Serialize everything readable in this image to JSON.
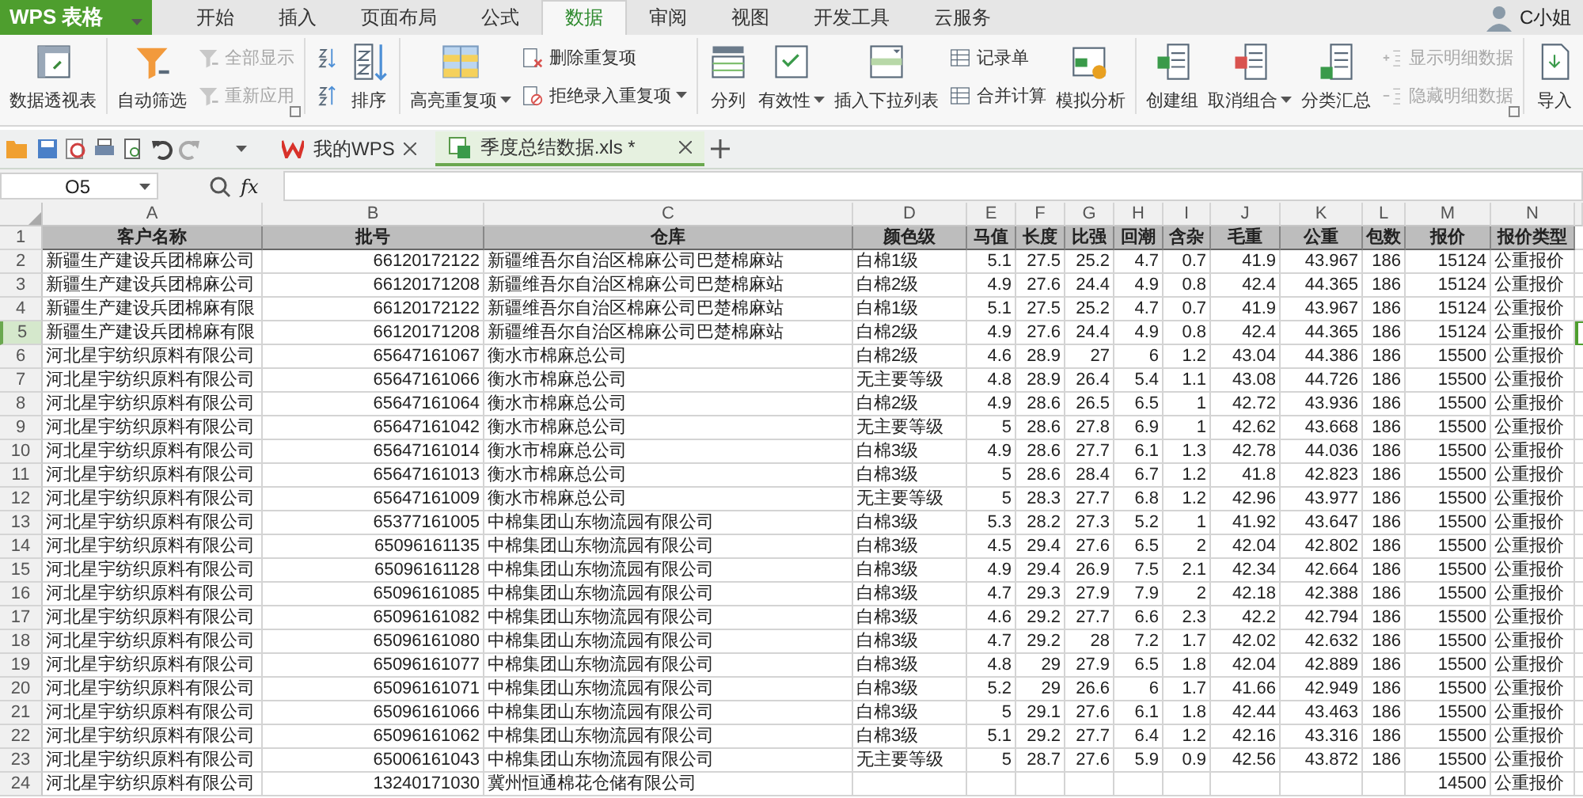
{
  "app": {
    "title": "WPS 表格"
  },
  "menu_tabs": [
    {
      "label": "开始",
      "selected": false
    },
    {
      "label": "插入",
      "selected": false
    },
    {
      "label": "页面布局",
      "selected": false
    },
    {
      "label": "公式",
      "selected": false
    },
    {
      "label": "数据",
      "selected": true
    },
    {
      "label": "审阅",
      "selected": false
    },
    {
      "label": "视图",
      "selected": false
    },
    {
      "label": "开发工具",
      "selected": false
    },
    {
      "label": "云服务",
      "selected": false
    }
  ],
  "user": {
    "name": "C小姐"
  },
  "ribbon": [
    {
      "columns": [
        [
          {
            "kind": "large",
            "label": "数据透视表",
            "disabled": false
          }
        ]
      ]
    },
    {
      "launcher": true,
      "columns": [
        [
          {
            "kind": "large",
            "label": "自动筛选",
            "disabled": false
          }
        ],
        [
          {
            "kind": "small",
            "label": "全部显示",
            "disabled": true
          },
          {
            "kind": "small",
            "label": "重新应用",
            "disabled": true
          }
        ]
      ]
    },
    {
      "columns": [
        [
          {
            "kind": "icon",
            "disabled": false
          },
          {
            "kind": "icon",
            "disabled": false
          }
        ],
        [
          {
            "kind": "large",
            "label": "排序",
            "disabled": false
          }
        ]
      ]
    },
    {
      "columns": [
        [
          {
            "kind": "large",
            "label": "高亮重复项",
            "disabled": false,
            "dropdown": true
          }
        ],
        [
          {
            "kind": "small",
            "label": "删除重复项",
            "disabled": false
          },
          {
            "kind": "small",
            "label": "拒绝录入重复项",
            "disabled": false,
            "dropdown": true
          }
        ]
      ]
    },
    {
      "columns": [
        [
          {
            "kind": "large",
            "label": "分列",
            "disabled": false
          }
        ],
        [
          {
            "kind": "large",
            "label": "有效性",
            "disabled": false,
            "dropdown": true
          }
        ],
        [
          {
            "kind": "large",
            "label": "插入下拉列表",
            "disabled": false
          }
        ],
        [
          {
            "kind": "small",
            "label": "记录单",
            "disabled": false
          },
          {
            "kind": "small",
            "label": "合并计算",
            "disabled": false
          }
        ],
        [
          {
            "kind": "large",
            "label": "模拟分析",
            "disabled": false
          }
        ]
      ]
    },
    {
      "launcher": true,
      "columns": [
        [
          {
            "kind": "large",
            "label": "创建组",
            "disabled": false
          }
        ],
        [
          {
            "kind": "large",
            "label": "取消组合",
            "disabled": false,
            "dropdown": true
          }
        ],
        [
          {
            "kind": "large",
            "label": "分类汇总",
            "disabled": false
          }
        ],
        [
          {
            "kind": "small",
            "label": "显示明细数据",
            "disabled": true
          },
          {
            "kind": "small",
            "label": "隐藏明细数据",
            "disabled": true
          }
        ]
      ]
    },
    {
      "columns": [
        [
          {
            "kind": "large",
            "label": "导入",
            "disabled": false
          }
        ]
      ]
    }
  ],
  "doc_tabs": [
    {
      "title": "我的WPS",
      "selected": false
    },
    {
      "title": "季度总结数据.xls *",
      "selected": true
    }
  ],
  "formula_bar": {
    "name_box": "O5",
    "fx": "fx"
  },
  "columns": [
    "A",
    "B",
    "C",
    "D",
    "E",
    "F",
    "G",
    "H",
    "I",
    "J",
    "K",
    "L",
    "M",
    "N"
  ],
  "header_row": {
    "number": "1",
    "cells": [
      "客户名称",
      "批号",
      "仓库",
      "颜色级",
      "马值",
      "长度",
      "比强",
      "回潮",
      "含杂",
      "毛重",
      "公重",
      "包数",
      "报价",
      "报价类型"
    ]
  },
  "rows": [
    {
      "number": "2",
      "selected": false,
      "cells": [
        "新疆生产建设兵团棉麻公司",
        "66120172122",
        "新疆维吾尔自治区棉麻公司巴楚棉麻站",
        "白棉1级",
        "5.1",
        "27.5",
        "25.2",
        "4.7",
        "0.7",
        "41.9",
        "43.967",
        "186",
        "15124",
        "公重报价"
      ]
    },
    {
      "number": "3",
      "selected": false,
      "cells": [
        "新疆生产建设兵团棉麻公司",
        "66120171208",
        "新疆维吾尔自治区棉麻公司巴楚棉麻站",
        "白棉2级",
        "4.9",
        "27.6",
        "24.4",
        "4.9",
        "0.8",
        "42.4",
        "44.365",
        "186",
        "15124",
        "公重报价"
      ]
    },
    {
      "number": "4",
      "selected": false,
      "cells": [
        "新疆生产建设兵团棉麻有限",
        "66120172122",
        "新疆维吾尔自治区棉麻公司巴楚棉麻站",
        "白棉1级",
        "5.1",
        "27.5",
        "25.2",
        "4.7",
        "0.7",
        "41.9",
        "43.967",
        "186",
        "15124",
        "公重报价"
      ]
    },
    {
      "number": "5",
      "selected": true,
      "cells": [
        "新疆生产建设兵团棉麻有限",
        "66120171208",
        "新疆维吾尔自治区棉麻公司巴楚棉麻站",
        "白棉2级",
        "4.9",
        "27.6",
        "24.4",
        "4.9",
        "0.8",
        "42.4",
        "44.365",
        "186",
        "15124",
        "公重报价"
      ]
    },
    {
      "number": "6",
      "selected": false,
      "cells": [
        "河北星宇纺织原料有限公司",
        "65647161067",
        "衡水市棉麻总公司",
        "白棉2级",
        "4.6",
        "28.9",
        "27",
        "6",
        "1.2",
        "43.04",
        "44.386",
        "186",
        "15500",
        "公重报价"
      ]
    },
    {
      "number": "7",
      "selected": false,
      "cells": [
        "河北星宇纺织原料有限公司",
        "65647161066",
        "衡水市棉麻总公司",
        "无主要等级",
        "4.8",
        "28.9",
        "26.4",
        "5.4",
        "1.1",
        "43.08",
        "44.726",
        "186",
        "15500",
        "公重报价"
      ]
    },
    {
      "number": "8",
      "selected": false,
      "cells": [
        "河北星宇纺织原料有限公司",
        "65647161064",
        "衡水市棉麻总公司",
        "白棉2级",
        "4.9",
        "28.6",
        "26.5",
        "6.5",
        "1",
        "42.72",
        "43.936",
        "186",
        "15500",
        "公重报价"
      ]
    },
    {
      "number": "9",
      "selected": false,
      "cells": [
        "河北星宇纺织原料有限公司",
        "65647161042",
        "衡水市棉麻总公司",
        "无主要等级",
        "5",
        "28.6",
        "27.8",
        "6.9",
        "1",
        "42.62",
        "43.668",
        "186",
        "15500",
        "公重报价"
      ]
    },
    {
      "number": "10",
      "selected": false,
      "cells": [
        "河北星宇纺织原料有限公司",
        "65647161014",
        "衡水市棉麻总公司",
        "白棉3级",
        "4.9",
        "28.6",
        "27.7",
        "6.1",
        "1.3",
        "42.78",
        "44.036",
        "186",
        "15500",
        "公重报价"
      ]
    },
    {
      "number": "11",
      "selected": false,
      "cells": [
        "河北星宇纺织原料有限公司",
        "65647161013",
        "衡水市棉麻总公司",
        "白棉3级",
        "5",
        "28.6",
        "28.4",
        "6.7",
        "1.2",
        "41.8",
        "42.823",
        "186",
        "15500",
        "公重报价"
      ]
    },
    {
      "number": "12",
      "selected": false,
      "cells": [
        "河北星宇纺织原料有限公司",
        "65647161009",
        "衡水市棉麻总公司",
        "无主要等级",
        "5",
        "28.3",
        "27.7",
        "6.8",
        "1.2",
        "42.96",
        "43.977",
        "186",
        "15500",
        "公重报价"
      ]
    },
    {
      "number": "13",
      "selected": false,
      "cells": [
        "河北星宇纺织原料有限公司",
        "65377161005",
        "中棉集团山东物流园有限公司",
        "白棉3级",
        "5.3",
        "28.2",
        "27.3",
        "5.2",
        "1",
        "41.92",
        "43.647",
        "186",
        "15500",
        "公重报价"
      ]
    },
    {
      "number": "14",
      "selected": false,
      "cells": [
        "河北星宇纺织原料有限公司",
        "65096161135",
        "中棉集团山东物流园有限公司",
        "白棉3级",
        "4.5",
        "29.4",
        "27.6",
        "6.5",
        "2",
        "42.04",
        "42.802",
        "186",
        "15500",
        "公重报价"
      ]
    },
    {
      "number": "15",
      "selected": false,
      "cells": [
        "河北星宇纺织原料有限公司",
        "65096161128",
        "中棉集团山东物流园有限公司",
        "白棉3级",
        "4.9",
        "29.4",
        "26.9",
        "7.5",
        "2.1",
        "42.34",
        "42.664",
        "186",
        "15500",
        "公重报价"
      ]
    },
    {
      "number": "16",
      "selected": false,
      "cells": [
        "河北星宇纺织原料有限公司",
        "65096161085",
        "中棉集团山东物流园有限公司",
        "白棉3级",
        "4.7",
        "29.3",
        "27.9",
        "7.9",
        "2",
        "42.18",
        "42.388",
        "186",
        "15500",
        "公重报价"
      ]
    },
    {
      "number": "17",
      "selected": false,
      "cells": [
        "河北星宇纺织原料有限公司",
        "65096161082",
        "中棉集团山东物流园有限公司",
        "白棉3级",
        "4.6",
        "29.2",
        "27.7",
        "6.6",
        "2.3",
        "42.2",
        "42.794",
        "186",
        "15500",
        "公重报价"
      ]
    },
    {
      "number": "18",
      "selected": false,
      "cells": [
        "河北星宇纺织原料有限公司",
        "65096161080",
        "中棉集团山东物流园有限公司",
        "白棉3级",
        "4.7",
        "29.2",
        "28",
        "7.2",
        "1.7",
        "42.02",
        "42.632",
        "186",
        "15500",
        "公重报价"
      ]
    },
    {
      "number": "19",
      "selected": false,
      "cells": [
        "河北星宇纺织原料有限公司",
        "65096161077",
        "中棉集团山东物流园有限公司",
        "白棉3级",
        "4.8",
        "29",
        "27.9",
        "6.5",
        "1.8",
        "42.04",
        "42.889",
        "186",
        "15500",
        "公重报价"
      ]
    },
    {
      "number": "20",
      "selected": false,
      "cells": [
        "河北星宇纺织原料有限公司",
        "65096161071",
        "中棉集团山东物流园有限公司",
        "白棉3级",
        "5.2",
        "29",
        "26.6",
        "6",
        "1.7",
        "41.66",
        "42.949",
        "186",
        "15500",
        "公重报价"
      ]
    },
    {
      "number": "21",
      "selected": false,
      "cells": [
        "河北星宇纺织原料有限公司",
        "65096161066",
        "中棉集团山东物流园有限公司",
        "白棉3级",
        "5",
        "29.1",
        "27.6",
        "6.1",
        "1.8",
        "42.44",
        "43.463",
        "186",
        "15500",
        "公重报价"
      ]
    },
    {
      "number": "22",
      "selected": false,
      "cells": [
        "河北星宇纺织原料有限公司",
        "65096161062",
        "中棉集团山东物流园有限公司",
        "白棉3级",
        "5.1",
        "29.2",
        "27.7",
        "6.4",
        "1.2",
        "42.16",
        "43.316",
        "186",
        "15500",
        "公重报价"
      ]
    },
    {
      "number": "23",
      "selected": false,
      "cells": [
        "河北星宇纺织原料有限公司",
        "65006161043",
        "中棉集团山东物流园有限公司",
        "无主要等级",
        "5",
        "28.7",
        "27.6",
        "5.9",
        "0.9",
        "42.56",
        "43.872",
        "186",
        "15500",
        "公重报价"
      ]
    },
    {
      "number": "24",
      "selected": false,
      "cells": [
        "河北星宇纺织原料有限公司",
        "13240171030",
        "冀州恒通棉花仓储有限公司",
        null,
        null,
        null,
        null,
        null,
        null,
        null,
        null,
        null,
        "14500",
        "公重报价"
      ]
    }
  ]
}
